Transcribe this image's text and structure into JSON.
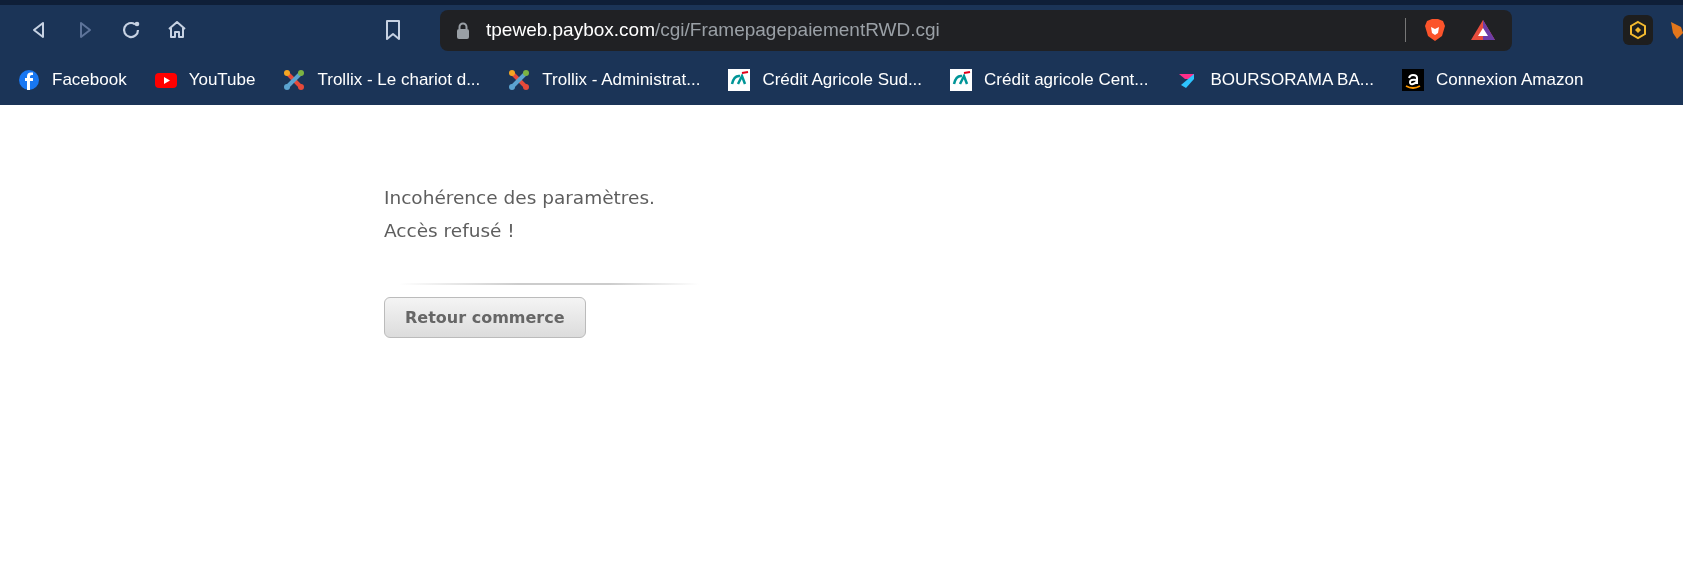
{
  "toolbar": {
    "nav_buttons": [
      {
        "kind": "back",
        "disabled": false
      },
      {
        "kind": "forward",
        "disabled": true
      },
      {
        "kind": "reload",
        "disabled": false
      },
      {
        "kind": "home",
        "disabled": false
      }
    ],
    "address": {
      "host": "tpeweb.paybox.com",
      "path": "/cgi/FramepagepaiementRWD.cgi"
    }
  },
  "bookmarks": [
    {
      "kind": "facebook",
      "label": "Facebook"
    },
    {
      "kind": "youtube",
      "label": "YouTube"
    },
    {
      "kind": "puzzle",
      "label": "Trollix - Le chariot d..."
    },
    {
      "kind": "puzzle",
      "label": "Trollix - Administrat..."
    },
    {
      "kind": "bank",
      "label": "Crédit Agricole Sud..."
    },
    {
      "kind": "bank",
      "label": "Crédit agricole Cent..."
    },
    {
      "kind": "arrow",
      "label": "BOURSORAMA BA..."
    },
    {
      "kind": "amazon",
      "label": "Connexion Amazon"
    }
  ],
  "page": {
    "messages": [
      "Incohérence des paramètres.",
      "Accès refusé !"
    ],
    "button": "Retour commerce"
  }
}
